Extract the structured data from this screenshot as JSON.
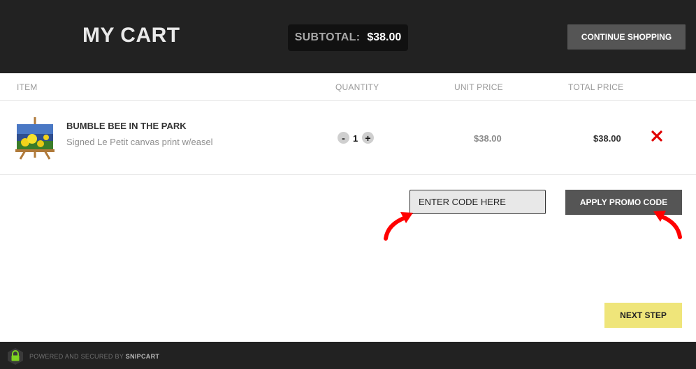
{
  "header": {
    "title": "MY CART",
    "subtotal_label": "SUBTOTAL:",
    "subtotal_value": "$38.00",
    "continue_label": "CONTINUE SHOPPING"
  },
  "columns": {
    "item": "ITEM",
    "quantity": "QUANTITY",
    "unit_price": "UNIT PRICE",
    "total_price": "TOTAL PRICE"
  },
  "items": [
    {
      "name": "BUMBLE BEE IN THE PARK",
      "description": "Signed Le Petit canvas print w/easel",
      "quantity": "1",
      "quantity_minus": "-",
      "quantity_plus": "+",
      "unit_price": "$38.00",
      "total_price": "$38.00",
      "image_icon": "canvas-print-on-easel",
      "remove_icon": "close-x-icon"
    }
  ],
  "promo": {
    "placeholder": "ENTER CODE HERE",
    "value": "",
    "apply_label": "APPLY PROMO CODE"
  },
  "actions": {
    "next_label": "NEXT STEP"
  },
  "footer": {
    "prefix": "POWERED AND SECURED BY",
    "brand": "SNIPCART",
    "lock_icon": "lock-icon"
  },
  "colors": {
    "header_bg": "#222222",
    "accent_yellow": "#efe57a",
    "remove_red": "#e00000",
    "annotation_arrow": "#ff0000",
    "lock_green": "#7ed321"
  }
}
